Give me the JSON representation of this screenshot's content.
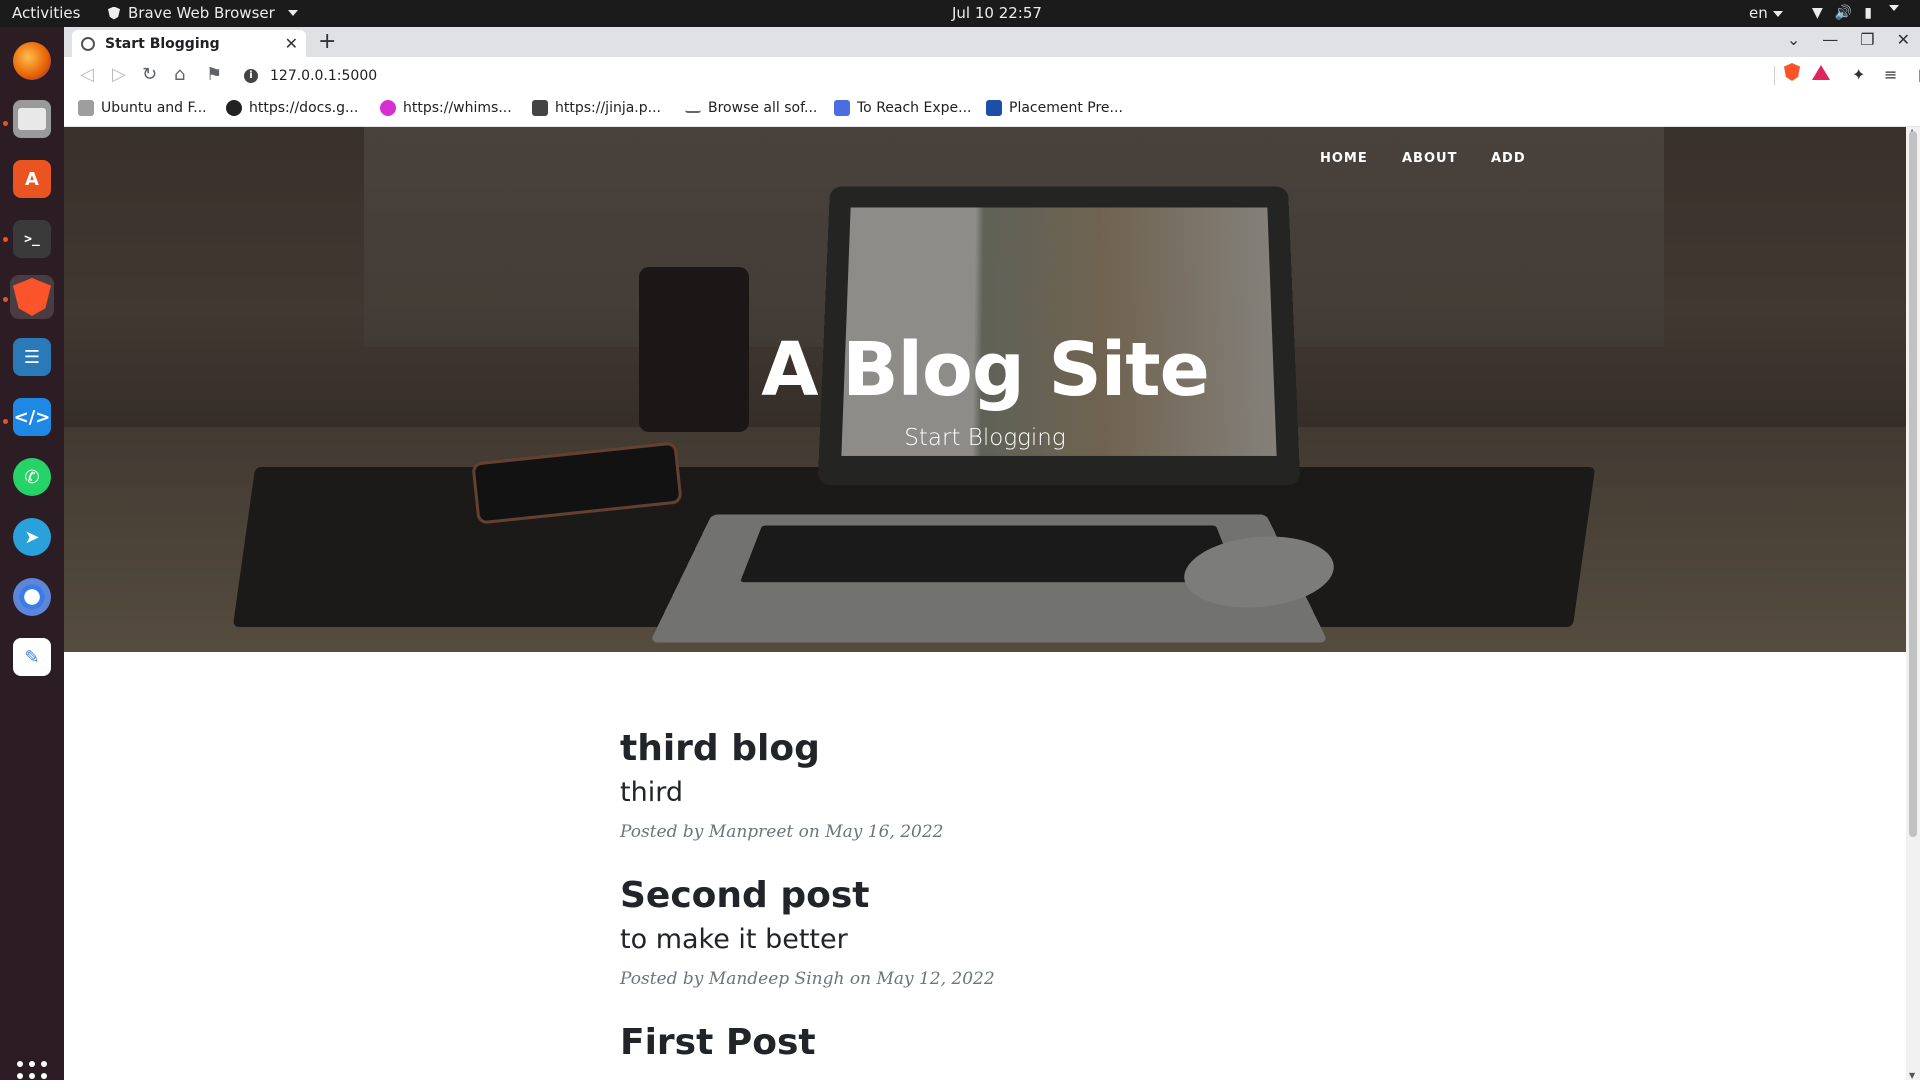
{
  "topbar": {
    "activities": "Activities",
    "app_name": "Brave Web Browser",
    "clock": "Jul 10  22:57",
    "lang": "en",
    "tray_icons": [
      "wifi-icon",
      "volume-icon",
      "battery-icon"
    ]
  },
  "dock": {
    "items": [
      {
        "name": "firefox",
        "color": "#e66000"
      },
      {
        "name": "files",
        "color": "#8c8c8c"
      },
      {
        "name": "ubuntu-software",
        "color": "#e95420"
      },
      {
        "name": "terminal",
        "color": "#2d2d2d"
      },
      {
        "name": "brave",
        "color": "#fb542b"
      },
      {
        "name": "libreoffice-writer",
        "color": "#2a7ab9"
      },
      {
        "name": "vscode",
        "color": "#1e88e5"
      },
      {
        "name": "whatsapp",
        "color": "#25d366"
      },
      {
        "name": "telegram",
        "color": "#2aa1da"
      },
      {
        "name": "chromium",
        "color": "#3b7ce8"
      },
      {
        "name": "text-editor",
        "color": "#3b7ce8"
      }
    ]
  },
  "browser": {
    "tab_title": "Start Blogging",
    "url": "127.0.0.1:5000",
    "bookmarks": [
      {
        "label": "Ubuntu and F...",
        "icon": "folder-icon"
      },
      {
        "label": "https://docs.g...",
        "icon": "github-icon"
      },
      {
        "label": "https://whims...",
        "icon": "m-icon"
      },
      {
        "label": "https://jinja.p...",
        "icon": "jinja-icon"
      },
      {
        "label": "Browse all sof...",
        "icon": "dash-icon"
      },
      {
        "label": "To Reach Expe...",
        "icon": "docs-icon"
      },
      {
        "label": "Placement Pre...",
        "icon": "word-icon"
      }
    ]
  },
  "site": {
    "nav": [
      "HOME",
      "ABOUT",
      "ADD"
    ],
    "title": "A Blog Site",
    "subtitle": "Start Blogging",
    "posts": [
      {
        "title": "third blog",
        "subtitle": "third",
        "posted_by": "Posted by",
        "author": "Manpreet",
        "on": "on",
        "date": "May 16, 2022"
      },
      {
        "title": "Second post",
        "subtitle": "to make it better",
        "posted_by": "Posted by",
        "author": "Mandeep Singh",
        "on": "on",
        "date": "May 12, 2022"
      },
      {
        "title": "First Post",
        "subtitle": "",
        "posted_by": "",
        "author": "",
        "on": "",
        "date": ""
      }
    ]
  }
}
